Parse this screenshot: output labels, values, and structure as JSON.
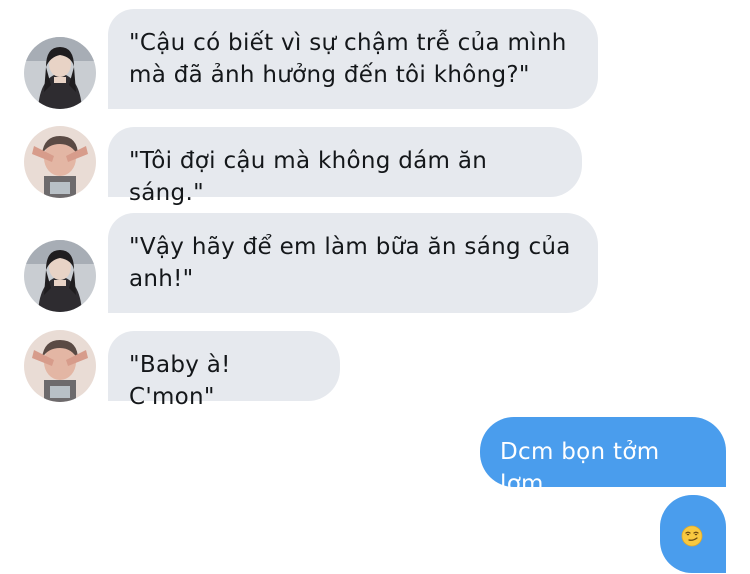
{
  "conversation": {
    "messages": [
      {
        "sender": "girl",
        "text": "\"Cậu có biết vì sự chậm trễ của mình\nmà đã ảnh hưởng đến tôi không?\""
      },
      {
        "sender": "boy",
        "text": "\"Tôi đợi cậu mà không dám ăn sáng.\""
      },
      {
        "sender": "girl",
        "text": "\"Vậy hãy để em làm bữa ăn sáng của\nanh!\""
      },
      {
        "sender": "boy",
        "text": "\"Baby à! C'mon\""
      },
      {
        "sender": "me",
        "text": "Dcm bọn tởm lợm"
      },
      {
        "sender": "me",
        "emoji": "smirking-face"
      }
    ]
  },
  "colors": {
    "incoming_bubble": "#e6e9ee",
    "outgoing_bubble": "#4a9ded",
    "incoming_text": "#14171a",
    "outgoing_text": "#ffffff"
  },
  "icons": {
    "girl_avatar": "avatar-girl",
    "boy_avatar": "avatar-boy",
    "emoji": "smirking-face-icon"
  }
}
